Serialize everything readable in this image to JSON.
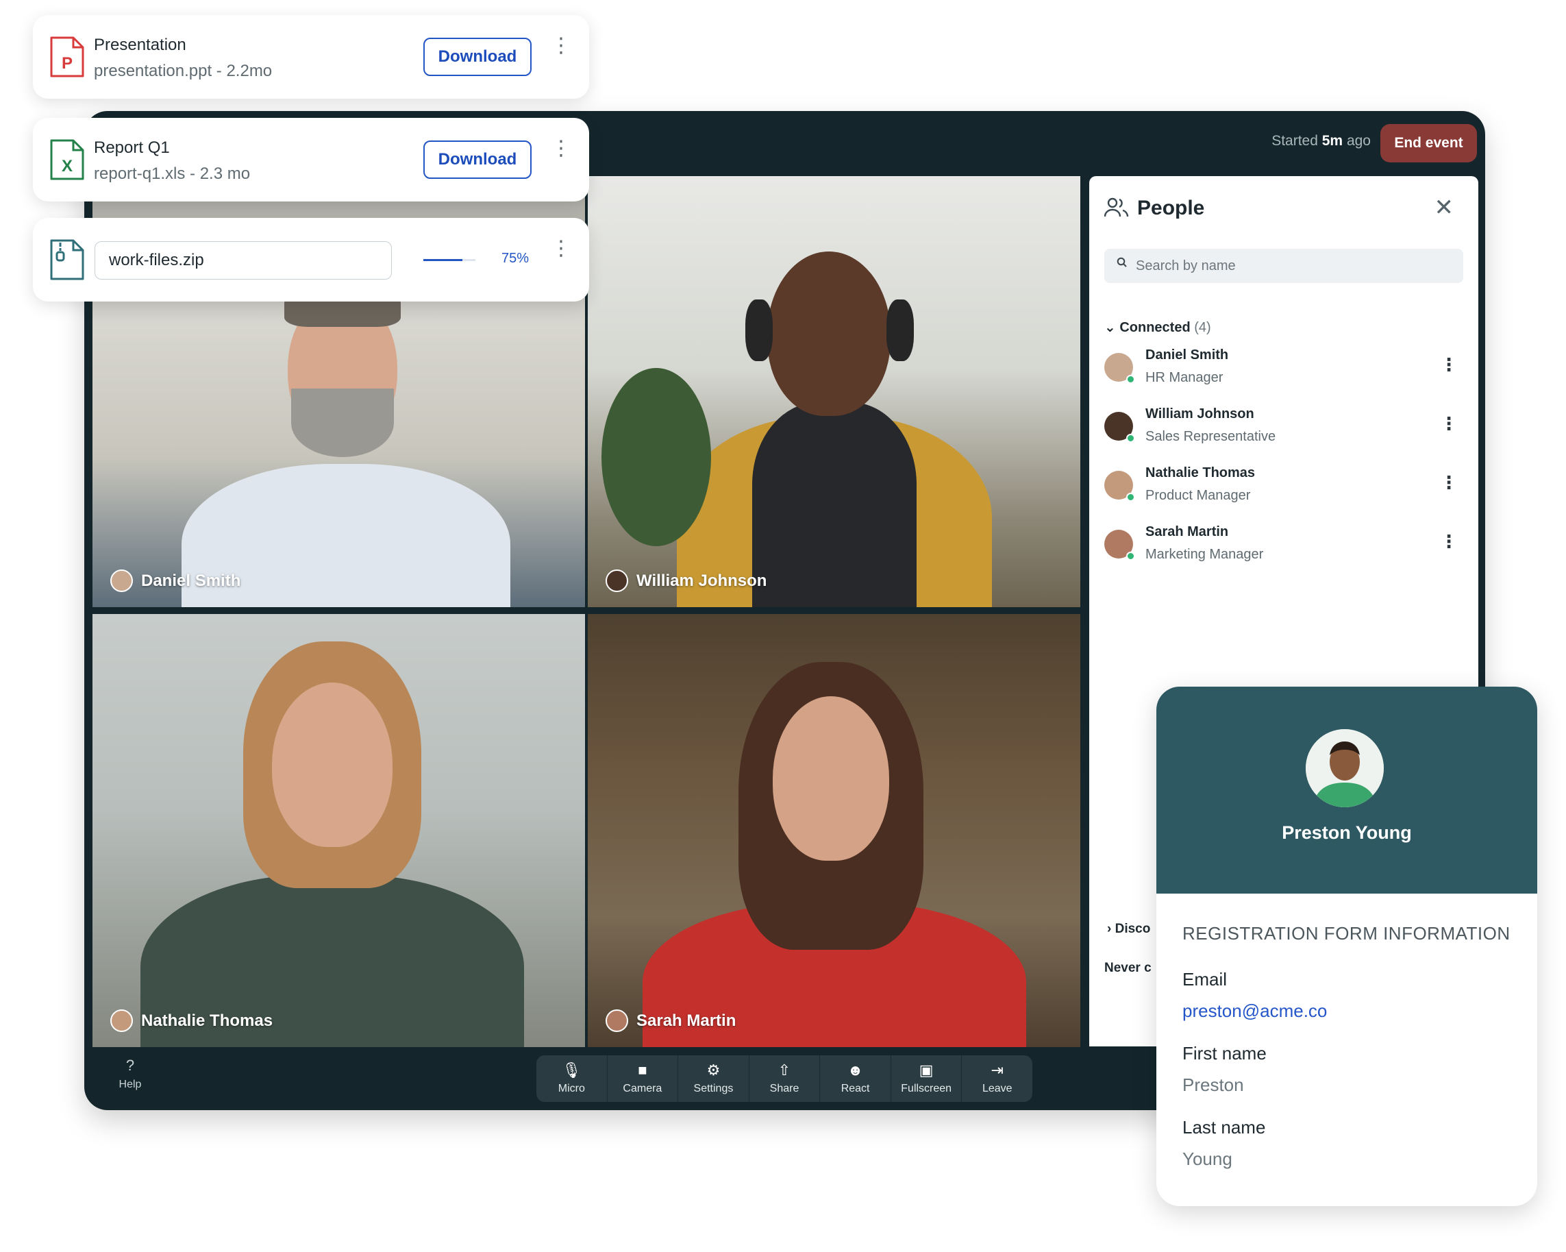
{
  "files": [
    {
      "title": "Presentation",
      "meta": "presentation.ppt -  2.2mo",
      "download_label": "Download",
      "icon": "ppt-file-icon",
      "icon_letter": "P",
      "color": "#d83b3b"
    },
    {
      "title": "Report Q1",
      "meta": "report-q1.xls - 2.3 mo",
      "download_label": "Download",
      "icon": "xls-file-icon",
      "icon_letter": "X",
      "color": "#23824a"
    }
  ],
  "upload": {
    "file_name": "work-files.zip",
    "progress": 0.75,
    "progress_label": "75%",
    "icon": "zip-file-icon"
  },
  "meeting": {
    "started_prefix": "Started",
    "started_value": "5m",
    "started_suffix": "ago",
    "end_label": "End event",
    "tiles": [
      {
        "name": "Daniel Smith"
      },
      {
        "name": "William Johnson"
      },
      {
        "name": "Nathalie Thomas"
      },
      {
        "name": "Sarah Martin"
      }
    ],
    "help_label": "Help",
    "controls": [
      {
        "label": "Micro",
        "icon": "microphone-icon",
        "glyph": "🎙"
      },
      {
        "label": "Camera",
        "icon": "camera-icon",
        "glyph": "■"
      },
      {
        "label": "Settings",
        "icon": "gear-icon",
        "glyph": "⚙"
      },
      {
        "label": "Share",
        "icon": "share-icon",
        "glyph": "⇧"
      },
      {
        "label": "React",
        "icon": "smiley-icon",
        "glyph": "☻"
      },
      {
        "label": "Fullscreen",
        "icon": "fullscreen-icon",
        "glyph": "▣"
      },
      {
        "label": "Leave",
        "icon": "leave-icon",
        "glyph": "⇥"
      }
    ]
  },
  "people_panel": {
    "title": "People",
    "search_placeholder": "Search by name",
    "connected_label": "Connected",
    "connected_count": "(4)",
    "people": [
      {
        "name": "Daniel Smith",
        "role": "HR Manager",
        "status_color": "#2fb574"
      },
      {
        "name": "William Johnson",
        "role": "Sales Representative",
        "status_color": "#2fb574"
      },
      {
        "name": "Nathalie Thomas",
        "role": "Product Manager",
        "status_color": "#2fb574"
      },
      {
        "name": "Sarah Martin",
        "role": "Marketing Manager",
        "status_color": "#2fb574"
      }
    ],
    "disconnected_label": "Disco",
    "never_label": "Never c"
  },
  "profile": {
    "name": "Preston Young",
    "section_title": "REGISTRATION FORM INFORMATION",
    "fields": [
      {
        "label": "Email",
        "value": "preston@acme.co"
      },
      {
        "label": "First name",
        "value": "Preston"
      },
      {
        "label": "Last name",
        "value": "Young"
      }
    ]
  },
  "colors": {
    "window_bg": "#14262c",
    "accent_blue": "#2355c5",
    "end_event": "#8a3a36",
    "profile_header": "#2f5962"
  }
}
